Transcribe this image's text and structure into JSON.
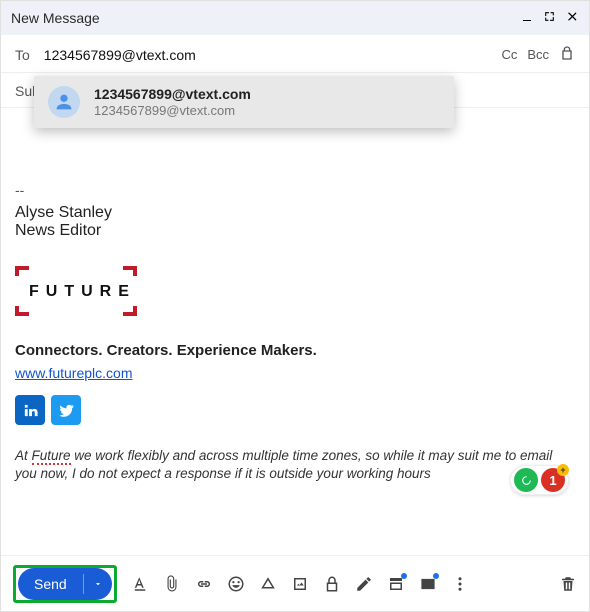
{
  "window": {
    "title": "New Message"
  },
  "to": {
    "label": "To",
    "value": "1234567899@vtext.com",
    "cc": "Cc",
    "bcc": "Bcc"
  },
  "subject": {
    "label": "Sub"
  },
  "suggestion": {
    "primary": "1234567899@vtext.com",
    "secondary": "1234567899@vtext.com"
  },
  "signature": {
    "dash": "--",
    "name": "Alyse Stanley",
    "role": "News Editor",
    "logo_text": "FUTURE",
    "tagline": "Connectors. Creators. Experience Makers.",
    "url": "www.futureplc.com",
    "note_pre": "At ",
    "note_future": "Future",
    "note_post": " we work flexibly and across multiple time zones, so while it may suit me to email you now, I do not expect a response if it is outside your working hours"
  },
  "badges": {
    "count": "1"
  },
  "toolbar": {
    "send": "Send"
  }
}
